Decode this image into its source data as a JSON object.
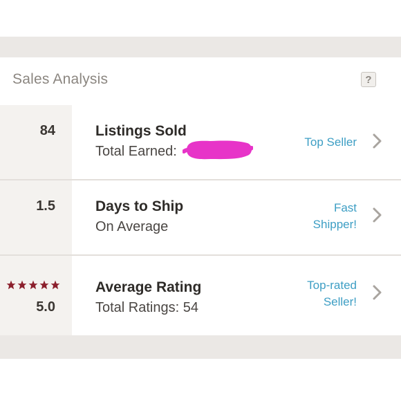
{
  "header": {
    "title": "Sales Analysis",
    "help_label": "?"
  },
  "rows": [
    {
      "metric": "84",
      "title": "Listings Sold",
      "subtitle": "Total Earned:",
      "badge_line1": "Top Seller",
      "badge_line2": ""
    },
    {
      "metric": "1.5",
      "title": "Days to Ship",
      "subtitle": "On Average",
      "badge_line1": "Fast",
      "badge_line2": "Shipper!"
    },
    {
      "metric": "5.0",
      "title": "Average Rating",
      "subtitle": "Total Ratings: 54",
      "badge_line1": "Top-rated",
      "badge_line2": "Seller!",
      "stars": 5
    }
  ],
  "colors": {
    "accent_link": "#3d9ec4",
    "star": "#8b1f2c",
    "redaction": "#e734c8"
  },
  "icons": [
    "question-icon",
    "chevron-right-icon",
    "star-icon"
  ]
}
